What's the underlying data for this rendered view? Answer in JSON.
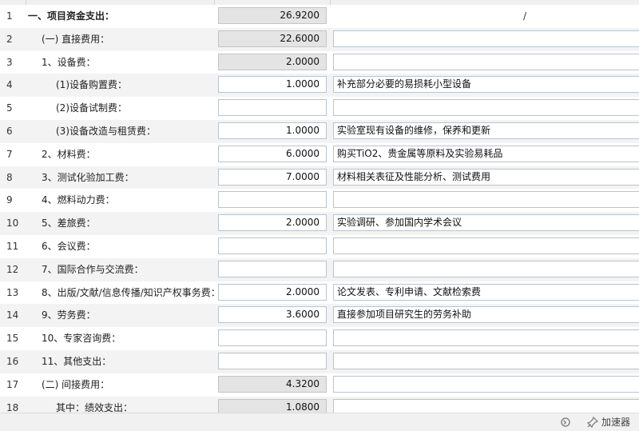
{
  "rows": [
    {
      "no": "1",
      "label": "一、项目资金支出：",
      "amount": "26.9200",
      "note": "/",
      "readonly": true
    },
    {
      "no": "2",
      "label": "(一) 直接费用：",
      "amount": "22.6000",
      "note": "",
      "readonly": true
    },
    {
      "no": "3",
      "label": "1、设备费：",
      "amount": "2.0000",
      "note": "",
      "readonly": true
    },
    {
      "no": "4",
      "label": "(1)设备购置费：",
      "amount": "1.0000",
      "note": "补充部分必要的易损耗小型设备",
      "readonly": false
    },
    {
      "no": "5",
      "label": "(2)设备试制费：",
      "amount": "",
      "note": "",
      "readonly": false
    },
    {
      "no": "6",
      "label": "(3)设备改造与租赁费：",
      "amount": "1.0000",
      "note": "实验室现有设备的维修，保养和更新",
      "readonly": false
    },
    {
      "no": "7",
      "label": "2、材料费：",
      "amount": "6.0000",
      "note": "购买TiO2、贵金属等原料及实验易耗品",
      "readonly": false
    },
    {
      "no": "8",
      "label": "3、测试化验加工费：",
      "amount": "7.0000",
      "note": "材料相关表征及性能分析、测试费用",
      "readonly": false
    },
    {
      "no": "9",
      "label": "4、燃料动力费：",
      "amount": "",
      "note": "",
      "readonly": false
    },
    {
      "no": "10",
      "label": "5、差旅费：",
      "amount": "2.0000",
      "note": "实验调研、参加国内学术会议",
      "readonly": false
    },
    {
      "no": "11",
      "label": "6、会议费：",
      "amount": "",
      "note": "",
      "readonly": false
    },
    {
      "no": "12",
      "label": "7、国际合作与交流费：",
      "amount": "",
      "note": "",
      "readonly": false
    },
    {
      "no": "13",
      "label": "8、出版/文献/信息传播/知识产权事务费：",
      "amount": "2.0000",
      "note": "论文发表、专利申请、文献检索费",
      "readonly": false
    },
    {
      "no": "14",
      "label": "9、劳务费：",
      "amount": "3.6000",
      "note": "直接参加项目研究生的劳务补助",
      "readonly": false
    },
    {
      "no": "15",
      "label": "10、专家咨询费：",
      "amount": "",
      "note": "",
      "readonly": false
    },
    {
      "no": "16",
      "label": "11、其他支出：",
      "amount": "",
      "note": "",
      "readonly": false
    },
    {
      "no": "17",
      "label": "(二) 间接费用：",
      "amount": "4.3200",
      "note": "",
      "readonly": true
    },
    {
      "no": "18",
      "label": "其中：绩效支出：",
      "amount": "1.0800",
      "note": "",
      "readonly": true
    }
  ],
  "status_bar": {
    "accelerator_label": "加速器",
    "refresh_icon": "refresh-icon",
    "pin_icon": "pin-icon"
  }
}
